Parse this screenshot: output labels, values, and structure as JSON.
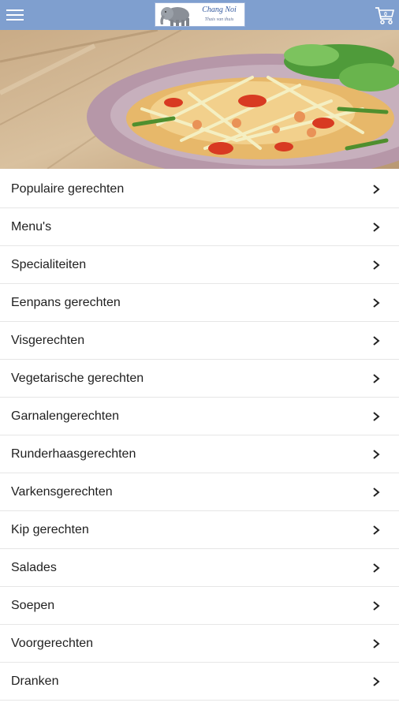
{
  "header": {
    "logo_name": "Chang Noi",
    "logo_tagline": "Thais van thuis",
    "cart_count": "0",
    "menu_icon": "hamburger-menu-icon",
    "cart_icon": "shopping-cart-icon"
  },
  "categories": [
    {
      "label": "Populaire gerechten"
    },
    {
      "label": "Menu's"
    },
    {
      "label": "Specialiteiten"
    },
    {
      "label": "Eenpans gerechten"
    },
    {
      "label": "Visgerechten"
    },
    {
      "label": "Vegetarische gerechten"
    },
    {
      "label": "Garnalengerechten"
    },
    {
      "label": "Runderhaasgerechten"
    },
    {
      "label": "Varkensgerechten"
    },
    {
      "label": "Kip gerechten"
    },
    {
      "label": "Salades"
    },
    {
      "label": "Soepen"
    },
    {
      "label": "Voorgerechten"
    },
    {
      "label": "Dranken"
    }
  ],
  "colors": {
    "header_bg": "#7f9fcf",
    "row_divider": "#e6e6e6"
  }
}
